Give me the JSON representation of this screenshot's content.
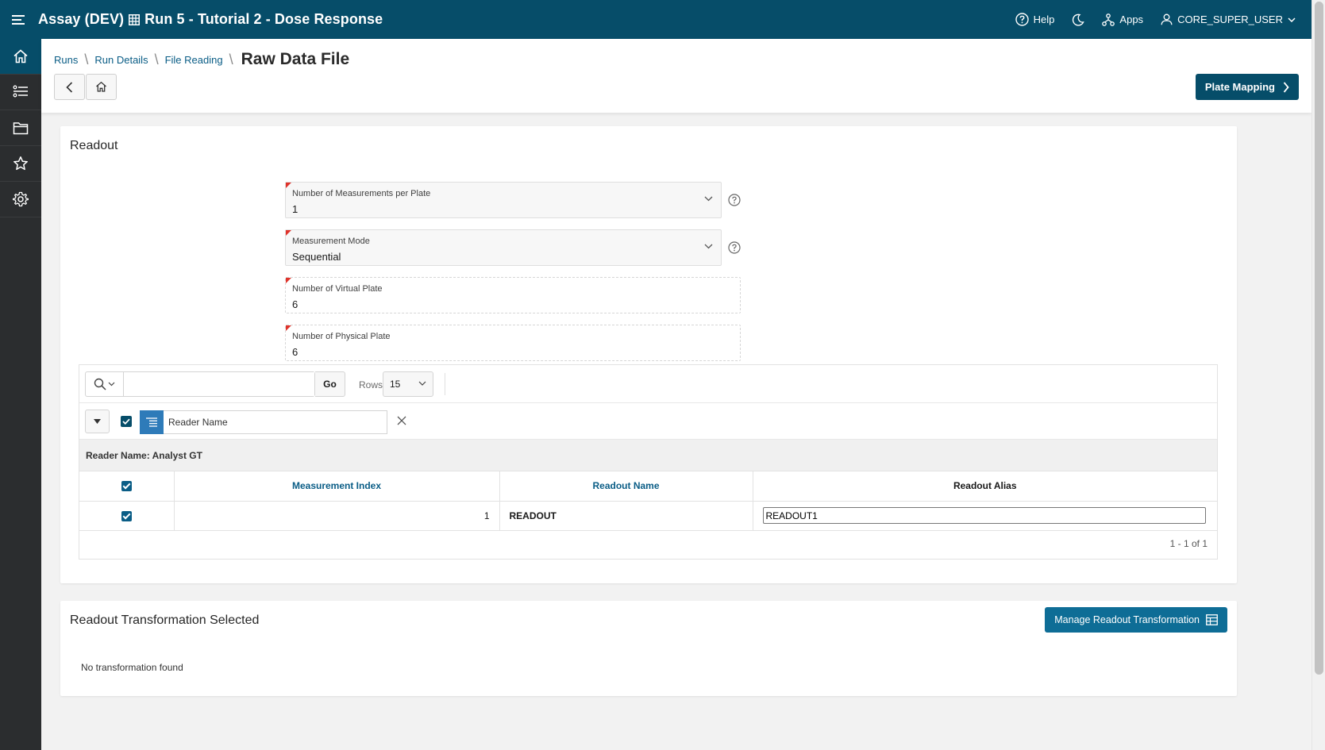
{
  "header": {
    "app_name": "Assay (DEV)",
    "page_context": "Run 5 - Tutorial 2 - Dose Response",
    "help_label": "Help",
    "apps_label": "Apps",
    "user_label": "CORE_SUPER_USER"
  },
  "sidebar": {
    "items": [
      {
        "icon": "home-icon",
        "active": true
      },
      {
        "icon": "list-icon",
        "active": false
      },
      {
        "icon": "folder-icon",
        "active": false
      },
      {
        "icon": "star-icon",
        "active": false
      },
      {
        "icon": "gear-icon",
        "active": false
      }
    ]
  },
  "breadcrumb": {
    "items": [
      "Runs",
      "Run Details",
      "File Reading"
    ],
    "current": "Raw Data File"
  },
  "actions": {
    "next_label": "Plate Mapping"
  },
  "readout": {
    "title": "Readout",
    "fields": {
      "measurements_per_plate": {
        "label": "Number of Measurements per Plate",
        "value": "1"
      },
      "measurement_mode": {
        "label": "Measurement Mode",
        "value": "Sequential"
      },
      "virtual_plate": {
        "label": "Number of Virtual Plate",
        "value": "6"
      },
      "physical_plate": {
        "label": "Number of Physical Plate",
        "value": "6"
      }
    },
    "report": {
      "search_value": "",
      "go_label": "Go",
      "rows_label": "Rows",
      "rows_value": "15",
      "filter_label": "Reader Name",
      "group_heading": "Reader Name: Analyst GT",
      "columns": [
        "Measurement Index",
        "Readout Name",
        "Readout Alias"
      ],
      "rows": [
        {
          "index": "1",
          "name": "READOUT",
          "alias": "READOUT1"
        }
      ],
      "pagination": "1 - 1 of 1"
    }
  },
  "transformation": {
    "title": "Readout Transformation Selected",
    "button_label": "Manage Readout Transformation",
    "empty_text": "No transformation found"
  },
  "colors": {
    "brand": "#064d69",
    "accent": "#0e6d96",
    "required": "#e0332b",
    "sidebar": "#2b2d2f"
  }
}
